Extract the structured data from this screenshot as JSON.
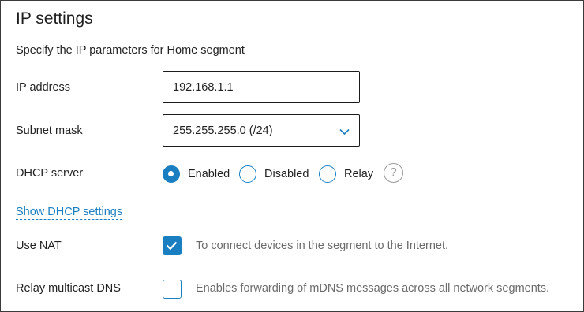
{
  "panel": {
    "title": "IP settings",
    "subtitle": "Specify the IP parameters for Home segment"
  },
  "ip_address": {
    "label": "IP address",
    "value": "192.168.1.1"
  },
  "subnet_mask": {
    "label": "Subnet mask",
    "value": "255.255.255.0 (/24)",
    "icon": "chevron-down-icon"
  },
  "dhcp": {
    "label": "DHCP server",
    "options": [
      {
        "label": "Enabled",
        "selected": true
      },
      {
        "label": "Disabled",
        "selected": false
      },
      {
        "label": "Relay",
        "selected": false
      }
    ],
    "help_icon": "help-icon",
    "help_glyph": "?"
  },
  "dhcp_link": {
    "label": "Show DHCP settings"
  },
  "nat": {
    "label": "Use NAT",
    "checked": true,
    "hint": "To connect devices in the segment to the Internet."
  },
  "mdns": {
    "label": "Relay multicast DNS",
    "checked": false,
    "hint": "Enables forwarding of mDNS messages across all network segments."
  },
  "colors": {
    "accent": "#1a7fc1",
    "border": "#1b1b1b",
    "hint_text": "#6b6b6b"
  }
}
